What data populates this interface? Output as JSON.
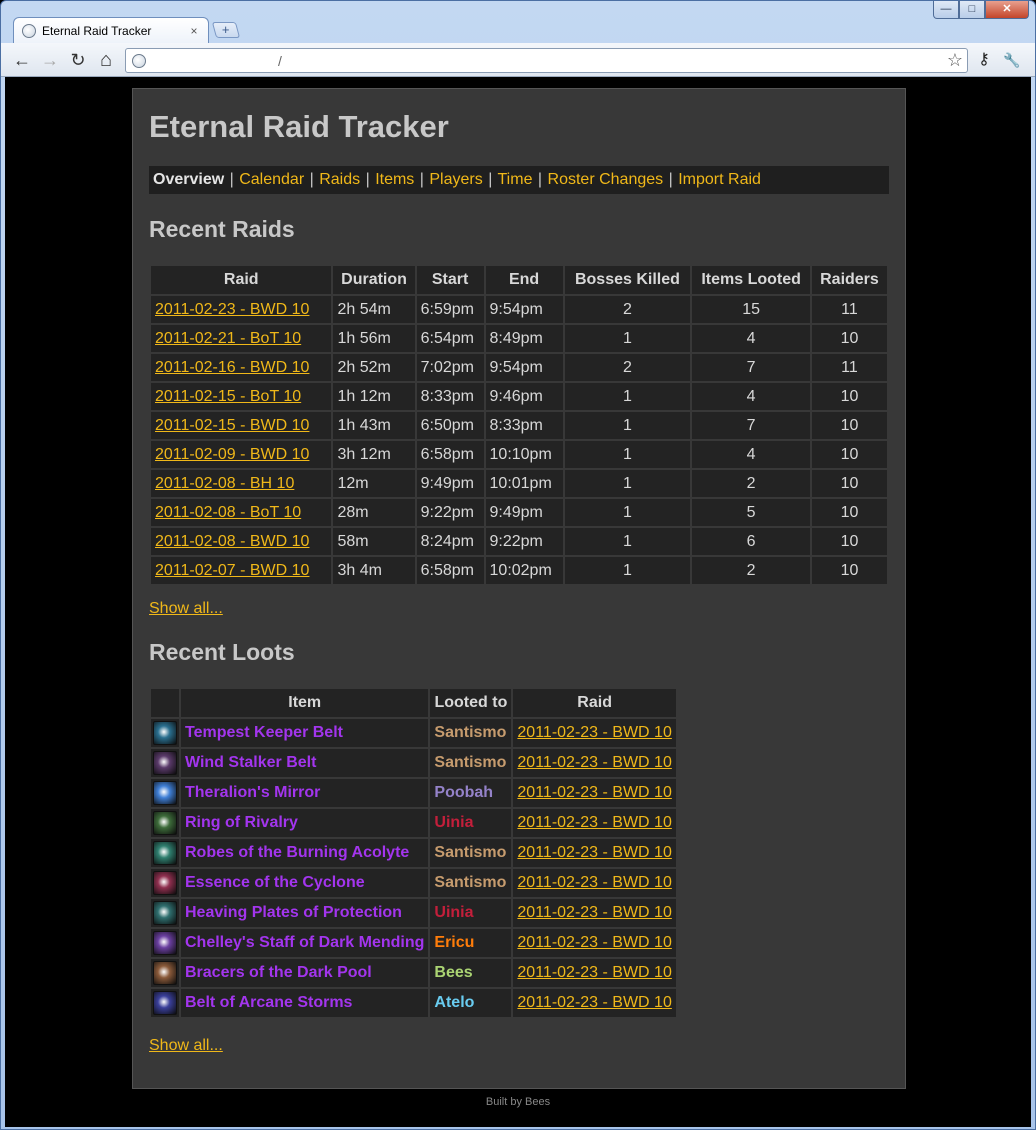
{
  "browser": {
    "tab_title": "Eternal Raid Tracker",
    "tab_close": "×",
    "new_tab": "+",
    "url": "/",
    "back": "←",
    "forward": "→",
    "reload": "↻",
    "home": "⌂",
    "star": "☆",
    "page_menu": "⚷",
    "wrench": "🔧",
    "minimize": "—",
    "maximize": "□",
    "close": "✕"
  },
  "page": {
    "title": "Eternal Raid Tracker",
    "nav": {
      "current": "Overview",
      "links": [
        "Calendar",
        "Raids",
        "Items",
        "Players",
        "Time",
        "Roster Changes",
        "Import Raid"
      ],
      "separator": "|"
    },
    "recent_raids": {
      "heading": "Recent Raids",
      "columns": [
        "Raid",
        "Duration",
        "Start",
        "End",
        "Bosses Killed",
        "Items Looted",
        "Raiders"
      ],
      "rows": [
        {
          "raid": "2011-02-23 - BWD 10",
          "duration": "2h 54m",
          "start": "6:59pm",
          "end": "9:54pm",
          "bosses": "2",
          "items": "15",
          "raiders": "11"
        },
        {
          "raid": "2011-02-21 - BoT 10",
          "duration": "1h 56m",
          "start": "6:54pm",
          "end": "8:49pm",
          "bosses": "1",
          "items": "4",
          "raiders": "10"
        },
        {
          "raid": "2011-02-16 - BWD 10",
          "duration": "2h 52m",
          "start": "7:02pm",
          "end": "9:54pm",
          "bosses": "2",
          "items": "7",
          "raiders": "11"
        },
        {
          "raid": "2011-02-15 - BoT 10",
          "duration": "1h 12m",
          "start": "8:33pm",
          "end": "9:46pm",
          "bosses": "1",
          "items": "4",
          "raiders": "10"
        },
        {
          "raid": "2011-02-15 - BWD 10",
          "duration": "1h 43m",
          "start": "6:50pm",
          "end": "8:33pm",
          "bosses": "1",
          "items": "7",
          "raiders": "10"
        },
        {
          "raid": "2011-02-09 - BWD 10",
          "duration": "3h 12m",
          "start": "6:58pm",
          "end": "10:10pm",
          "bosses": "1",
          "items": "4",
          "raiders": "10"
        },
        {
          "raid": "2011-02-08 - BH 10",
          "duration": "12m",
          "start": "9:49pm",
          "end": "10:01pm",
          "bosses": "1",
          "items": "2",
          "raiders": "10"
        },
        {
          "raid": "2011-02-08 - BoT 10",
          "duration": "28m",
          "start": "9:22pm",
          "end": "9:49pm",
          "bosses": "1",
          "items": "5",
          "raiders": "10"
        },
        {
          "raid": "2011-02-08 - BWD 10",
          "duration": "58m",
          "start": "8:24pm",
          "end": "9:22pm",
          "bosses": "1",
          "items": "6",
          "raiders": "10"
        },
        {
          "raid": "2011-02-07 - BWD 10",
          "duration": "3h 4m",
          "start": "6:58pm",
          "end": "10:02pm",
          "bosses": "1",
          "items": "2",
          "raiders": "10"
        }
      ],
      "show_all": "Show all..."
    },
    "recent_loots": {
      "heading": "Recent Loots",
      "columns": [
        "",
        "Item",
        "Looted to",
        "Raid"
      ],
      "rows": [
        {
          "icon": "belt-icon",
          "icon_color": "#2a6f8f",
          "item": "Tempest Keeper Belt",
          "player": "Santismo",
          "player_color": "#c79c6e",
          "raid": "2011-02-23 - BWD 10"
        },
        {
          "icon": "eye-belt-icon",
          "icon_color": "#5a3a6a",
          "item": "Wind Stalker Belt",
          "player": "Santismo",
          "player_color": "#c79c6e",
          "raid": "2011-02-23 - BWD 10"
        },
        {
          "icon": "orb-icon",
          "icon_color": "#3f7fd6",
          "item": "Theralion's Mirror",
          "player": "Poobah",
          "player_color": "#9482c9",
          "raid": "2011-02-23 - BWD 10"
        },
        {
          "icon": "ring-icon",
          "icon_color": "#3d6b3a",
          "item": "Ring of Rivalry",
          "player": "Uinia",
          "player_color": "#c41f3b",
          "raid": "2011-02-23 - BWD 10"
        },
        {
          "icon": "robe-icon",
          "icon_color": "#2f7f6f",
          "item": "Robes of the Burning Acolyte",
          "player": "Santismo",
          "player_color": "#c79c6e",
          "raid": "2011-02-23 - BWD 10"
        },
        {
          "icon": "essence-icon",
          "icon_color": "#8f2f4f",
          "item": "Essence of the Cyclone",
          "player": "Santismo",
          "player_color": "#c79c6e",
          "raid": "2011-02-23 - BWD 10"
        },
        {
          "icon": "chest-icon",
          "icon_color": "#2f6f6f",
          "item": "Heaving Plates of Protection",
          "player": "Uinia",
          "player_color": "#c41f3b",
          "raid": "2011-02-23 - BWD 10"
        },
        {
          "icon": "staff-icon",
          "icon_color": "#6a3fa0",
          "item": "Chelley's Staff of Dark Mending",
          "player": "Ericu",
          "player_color": "#ff7d0a",
          "raid": "2011-02-23 - BWD 10"
        },
        {
          "icon": "bracers-icon",
          "icon_color": "#8a5a3a",
          "item": "Bracers of the Dark Pool",
          "player": "Bees",
          "player_color": "#abd473",
          "raid": "2011-02-23 - BWD 10"
        },
        {
          "icon": "arcane-belt-icon",
          "icon_color": "#3a3f9a",
          "item": "Belt of Arcane Storms",
          "player": "Atelo",
          "player_color": "#69ccf0",
          "raid": "2011-02-23 - BWD 10"
        }
      ],
      "show_all": "Show all..."
    },
    "footer": "Built by Bees"
  },
  "colors": {
    "link": "#f0b819",
    "epic": "#a335ee",
    "panel": "#383838",
    "cell": "#232323"
  }
}
